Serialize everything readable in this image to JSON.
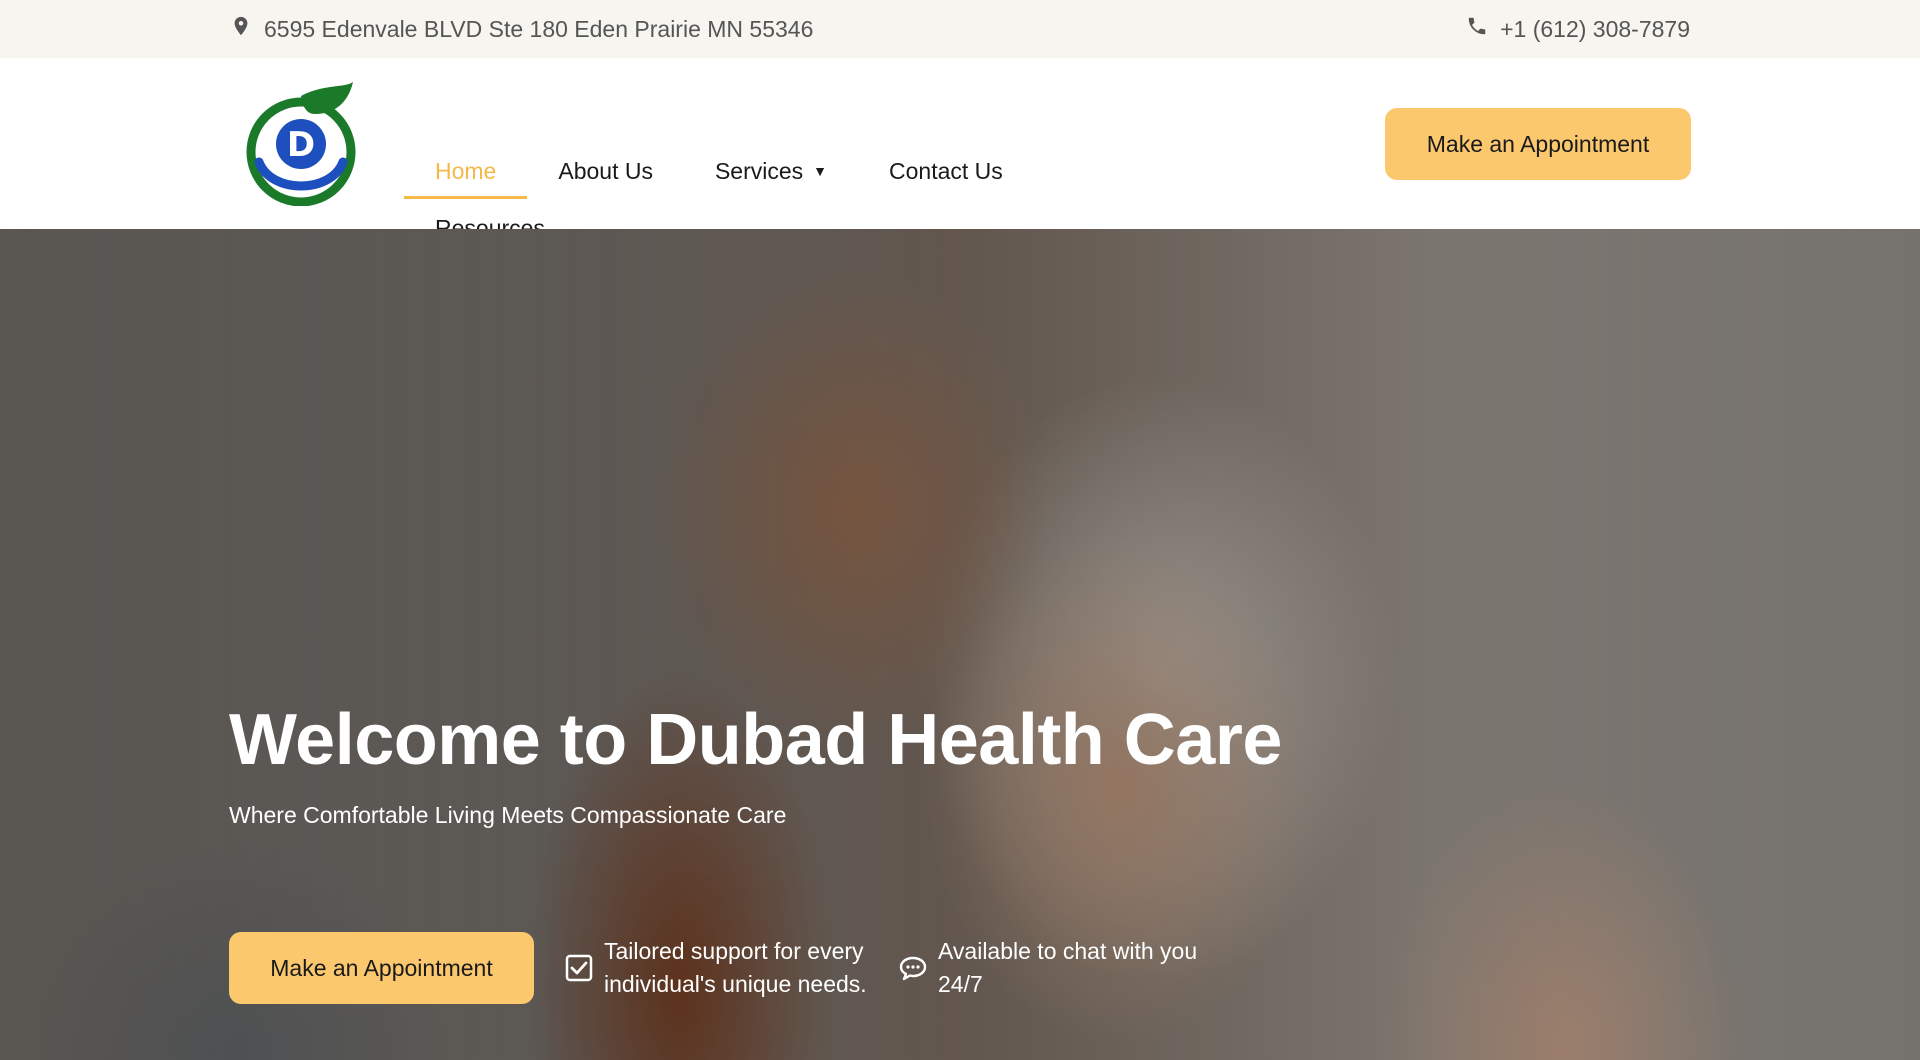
{
  "topbar": {
    "address": "6595 Edenvale BLVD Ste 180 Eden Prairie MN 55346",
    "phone": "+1 (612) 308-7879",
    "address_icon": "map-pin-icon",
    "phone_icon": "phone-icon"
  },
  "brand": {
    "logo_letter": "D",
    "logo_colors": {
      "ring": "#1b7a2a",
      "leaf": "#1b7a2a",
      "letter": "#1e4fbf"
    }
  },
  "nav": {
    "items": [
      {
        "label": "Home",
        "active": true
      },
      {
        "label": "About Us",
        "active": false
      },
      {
        "label": "Services",
        "active": false,
        "has_dropdown": true
      },
      {
        "label": "Contact Us",
        "active": false
      },
      {
        "label": "Resources",
        "active": false
      }
    ],
    "cta_label": "Make an Appointment"
  },
  "hero": {
    "title": "Welcome to Dubad Health Care",
    "subtitle": "Where Comfortable Living Meets Compassionate Care",
    "cta_label": "Make an Appointment",
    "features": [
      {
        "icon": "checkbox-icon",
        "text": "Tailored support for every individual's unique needs."
      },
      {
        "icon": "chat-bubble-icon",
        "text": "Available to chat with you 24/7"
      }
    ]
  },
  "colors": {
    "accent": "#fbc86e",
    "active_nav": "#f5b94a",
    "topbar_bg": "#f7f5ef"
  }
}
